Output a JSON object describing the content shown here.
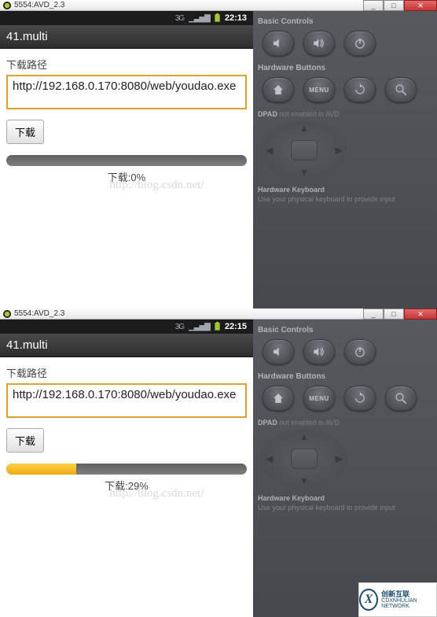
{
  "window": {
    "title": "5554:AVD_2.3",
    "min": "_",
    "max": "□",
    "close": "✕"
  },
  "screenshots": [
    {
      "status_bar": {
        "clock": "22:13",
        "net": "3G"
      },
      "app_title": "41.multi",
      "label": "下载路径",
      "url": "http://192.168.0.170:8080/web/youdao.exe",
      "button_label": "下载",
      "progress_percent": 0,
      "progress_text": "下载:0%",
      "watermark": "http://blog.csdn.net/"
    },
    {
      "status_bar": {
        "clock": "22:15",
        "net": "3G"
      },
      "app_title": "41.multi",
      "label": "下载路径",
      "url": "http://192.168.0.170:8080/web/youdao.exe",
      "button_label": "下载",
      "progress_percent": 29,
      "progress_text": "下载:29%",
      "watermark": "http://blog.csdn.net/"
    }
  ],
  "controls": {
    "basic_title": "Basic Controls",
    "hardware_title": "Hardware Buttons",
    "menu_label": "MENU",
    "dpad_label": "DPAD",
    "dpad_disabled": "not enabled in AVD",
    "hw_kb_title": "Hardware Keyboard",
    "hw_kb_text": "Use your physical keyboard to provide input"
  },
  "logo": {
    "brand": "创新互联",
    "sub": "CDXNHULIAN NETWORK"
  }
}
